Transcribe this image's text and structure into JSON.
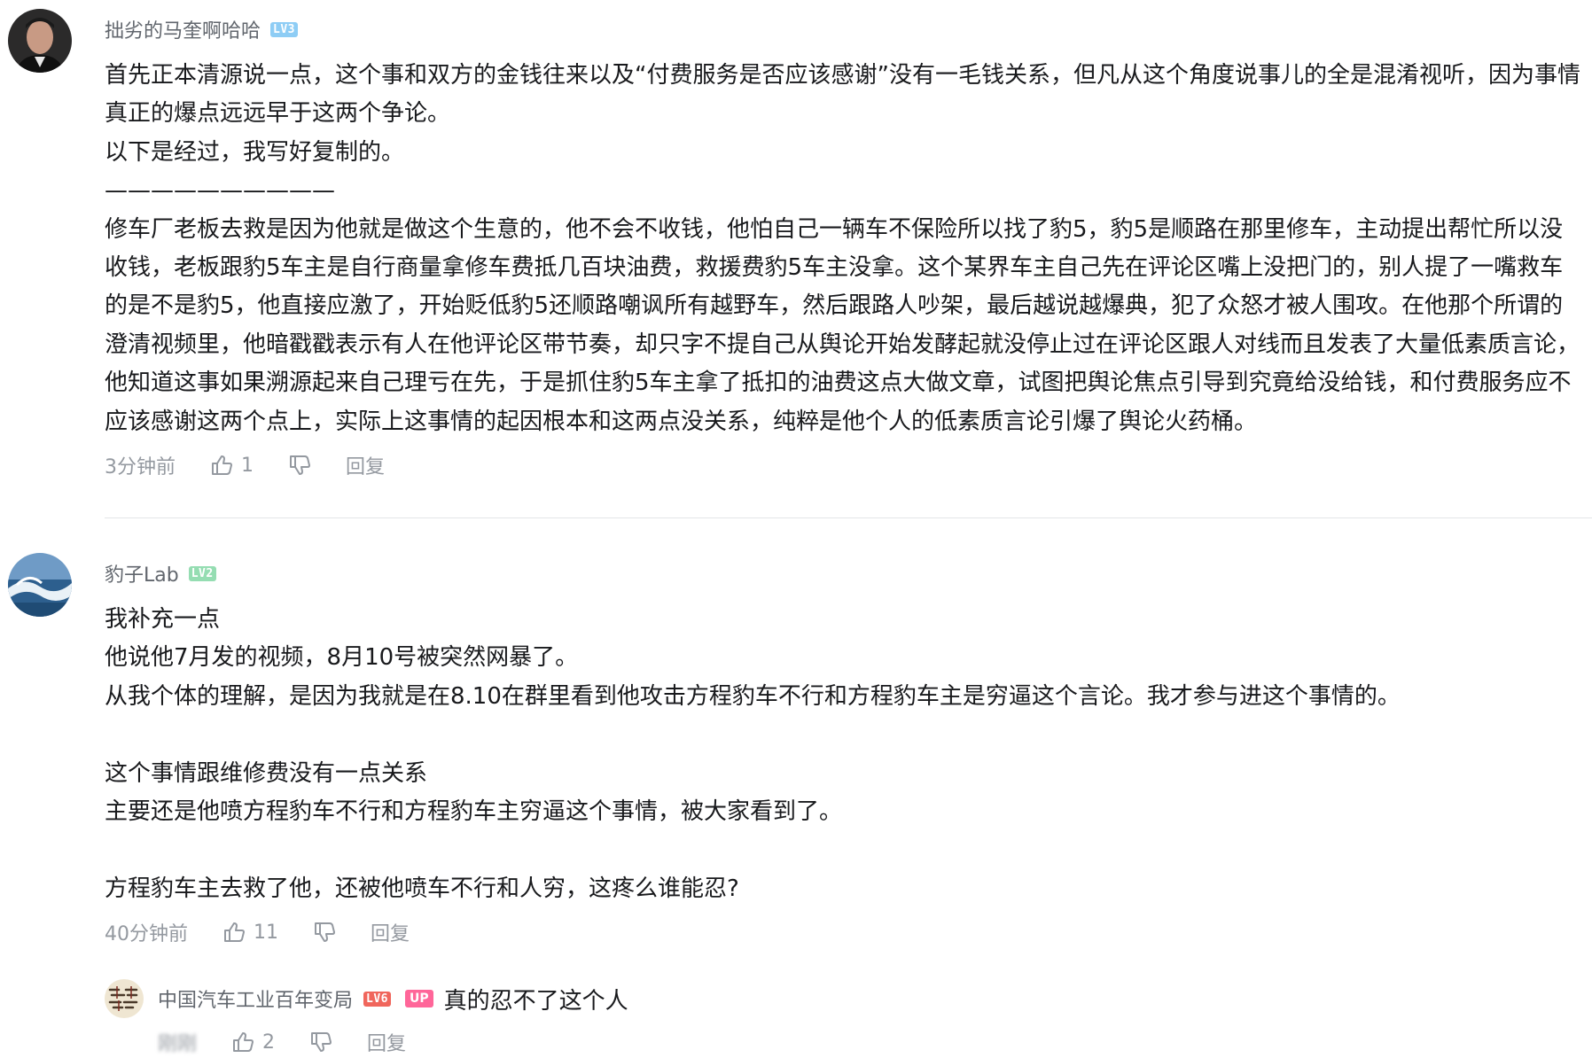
{
  "comments": [
    {
      "username": "拙劣的马奎啊哈哈",
      "level": "LV3",
      "content": [
        "首先正本清源说一点，这个事和双方的金钱往来以及“付费服务是否应该感谢”没有一毛钱关系，但凡从这个角度说事儿的全是混淆视听，因为事情真正的爆点远远早于这两个争论。",
        "以下是经过，我写好复制的。",
        "——————————",
        "修车厂老板去救是因为他就是做这个生意的，他不会不收钱，他怕自己一辆车不保险所以找了豹5，豹5是顺路在那里修车，主动提出帮忙所以没收钱，老板跟豹5车主是自行商量拿修车费抵几百块油费，救援费豹5车主没拿。这个某界车主自己先在评论区嘴上没把门的，别人提了一嘴救车的是不是豹5，他直接应激了，开始贬低豹5还顺路嘲讽所有越野车，然后跟路人吵架，最后越说越爆典，犯了众怒才被人围攻。在他那个所谓的澄清视频里，他暗戳戳表示有人在他评论区带节奏，却只字不提自己从舆论开始发酵起就没停止过在评论区跟人对线而且发表了大量低素质言论，他知道这事如果溯源起来自己理亏在先，于是抓住豹5车主拿了抵扣的油费这点大做文章，试图把舆论焦点引导到究竟给没给钱，和付费服务应不应该感谢这两个点上，实际上这事情的起因根本和这两点没关系，纯粹是他个人的低素质言论引爆了舆论火药桶。"
      ],
      "time": "3分钟前",
      "likes": "1",
      "reply_label": "回复"
    },
    {
      "username": "豹子Lab",
      "level": "LV2",
      "content": [
        "我补充一点",
        "他说他7月发的视频，8月10号被突然网暴了。",
        "从我个体的理解，是因为我就是在8.10在群里看到他攻击方程豹车不行和方程豹车主是穷逼这个言论。我才参与进这个事情的。",
        "",
        "这个事情跟维修费没有一点关系",
        "主要还是他喷方程豹车不行和方程豹车主穷逼这个事情，被大家看到了。",
        "",
        "方程豹车主去救了他，还被他喷车不行和人穷，这疼么谁能忍?"
      ],
      "time": "40分钟前",
      "likes": "11",
      "reply_label": "回复",
      "sub_reply": {
        "username": "中国汽车工业百年变局",
        "level": "LV6",
        "badge": "UP",
        "text": "真的忍不了这个人",
        "time": "刚刚",
        "likes": "2",
        "reply_label": "回复"
      }
    }
  ],
  "icons": {
    "like": "thumbs-up-icon",
    "dislike": "thumbs-down-icon"
  },
  "colors": {
    "lv3": "#8ecdf5",
    "lv2": "#95ddb2",
    "lv6": "#f0665c",
    "up": "#ff6699",
    "meta": "#9499a0"
  }
}
